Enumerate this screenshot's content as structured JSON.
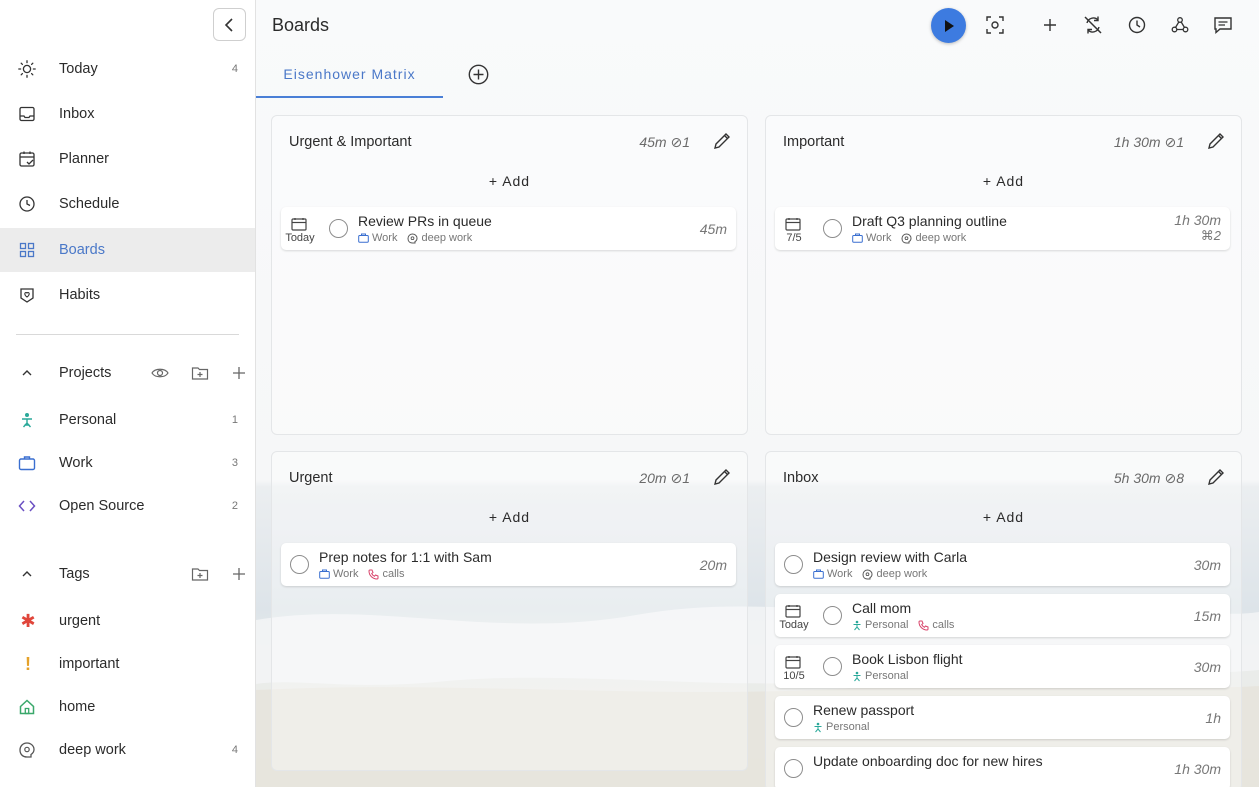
{
  "sidebar": {
    "nav": [
      {
        "label": "Today",
        "count": "4",
        "icon": "sun-icon"
      },
      {
        "label": "Inbox",
        "count": "",
        "icon": "inbox-icon"
      },
      {
        "label": "Planner",
        "count": "",
        "icon": "planner-icon"
      },
      {
        "label": "Schedule",
        "count": "",
        "icon": "clock-icon"
      },
      {
        "label": "Boards",
        "count": "",
        "icon": "grid-icon"
      },
      {
        "label": "Habits",
        "count": "",
        "icon": "habits-icon"
      }
    ],
    "projects_title": "Projects",
    "projects": [
      {
        "label": "Personal",
        "count": "1",
        "icon": "person-icon"
      },
      {
        "label": "Work",
        "count": "3",
        "icon": "briefcase-icon"
      },
      {
        "label": "Open Source",
        "count": "2",
        "icon": "code-icon"
      }
    ],
    "tags_title": "Tags",
    "tags": [
      {
        "label": "urgent",
        "count": "",
        "glyph": "✱",
        "color": "#e0453a"
      },
      {
        "label": "important",
        "count": "",
        "glyph": "!",
        "color": "#e5a22a"
      },
      {
        "label": "home",
        "count": "",
        "glyph": "",
        "color": "#3aa86b"
      },
      {
        "label": "deep work",
        "count": "4",
        "glyph": "",
        "color": "#555555"
      }
    ]
  },
  "header": {
    "title": "Boards",
    "accent_color": "#3d7be0"
  },
  "tabs": [
    {
      "label": "Eisenhower Matrix"
    }
  ],
  "board": {
    "add_label": "Add",
    "quadrants": [
      {
        "title": "Urgent & Important",
        "meta": "45m ⊘1",
        "tasks": [
          {
            "title": "Review PRs in queue",
            "date": "Today",
            "tags": [
              "Work",
              "deep work"
            ],
            "duration": "45m",
            "extra": ""
          }
        ]
      },
      {
        "title": "Important",
        "meta": "1h 30m ⊘1",
        "tasks": [
          {
            "title": "Draft Q3 planning outline",
            "date": "7/5",
            "tags": [
              "Work",
              "deep work"
            ],
            "duration": "1h 30m",
            "extra": "⌘2"
          }
        ]
      },
      {
        "title": "Urgent",
        "meta": "20m ⊘1",
        "tasks": [
          {
            "title": "Prep notes for 1:1 with Sam",
            "date": "",
            "tags": [
              "Work",
              "calls"
            ],
            "duration": "20m",
            "extra": ""
          }
        ]
      },
      {
        "title": "Inbox",
        "meta": "5h 30m ⊘8",
        "tasks": [
          {
            "title": "Design review with Carla",
            "date": "",
            "tags": [
              "Work",
              "deep work"
            ],
            "duration": "30m",
            "extra": ""
          },
          {
            "title": "Call mom",
            "date": "Today",
            "tags": [
              "Personal",
              "calls"
            ],
            "duration": "15m",
            "extra": ""
          },
          {
            "title": "Book Lisbon flight",
            "date": "10/5",
            "tags": [
              "Personal"
            ],
            "duration": "30m",
            "extra": ""
          },
          {
            "title": "Renew passport",
            "date": "",
            "tags": [
              "Personal"
            ],
            "duration": "1h",
            "extra": ""
          },
          {
            "title": "Update onboarding doc for new hires",
            "date": "",
            "tags": [],
            "duration": "1h 30m",
            "extra": ""
          }
        ]
      }
    ]
  }
}
